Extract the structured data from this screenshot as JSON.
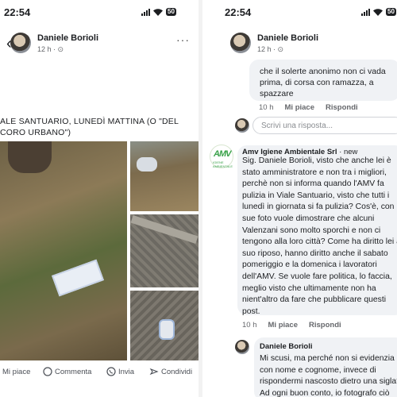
{
  "left": {
    "status": {
      "time": "22:54",
      "battery": "50"
    },
    "author": {
      "name": "Daniele Borioli",
      "meta": "12 h · ⊙"
    },
    "post_text": "ALE SANTUARIO, LUNEDÌ MATTINA (O \"DEL\nCORO URBANO\")",
    "actions": {
      "like": "Mi piace",
      "comment": "Commenta",
      "send": "Invia",
      "share": "Condividi"
    }
  },
  "right": {
    "status": {
      "time": "22:54",
      "battery": "50"
    },
    "author": {
      "name": "Daniele Borioli",
      "meta": "12 h · ⊙"
    },
    "prev_comment": "che il solerte anonimo non ci vada\nprima, di corsa con ramazza, a\nspazzare",
    "prev_links": {
      "time": "10 h",
      "like": "Mi piace",
      "reply": "Rispondi"
    },
    "reply_placeholder": "Scrivi una risposta...",
    "amv_comment": {
      "author": "Amv Igiene Ambientale Srl",
      "badge": "· new",
      "logo_text": "AMV",
      "logo_sub": "IGIENE AMBIENTALE",
      "text": "Sig. Daniele Borioli, visto che anche lei è stato amministratore e non tra i migliori, perchè non si informa quando l'AMV fa pulizia in Viale Santuario, visto che tutti i lunedì in giornata si fa pulizia? Cos'è, con le sue foto vuole dimostrare che alcuni Valenzani sono molto sporchi e non ci tengono alla loro città? Come ha diritto lei al suo riposo, hanno diritto anche il sabato pomeriggio e la domenica i lavoratori dell'AMV. Se vuole fare politica, lo faccia, meglio visto che ultimamente non ha nient'altro da fare che pubblicare questi post.",
      "links": {
        "time": "10 h",
        "like": "Mi piace",
        "reply": "Rispondi"
      }
    },
    "reply_comment": {
      "author": "Daniele Borioli",
      "text": "Mi scusi, ma perché non si evidenzia con nome e cognome, invece di rispondermi nascosto dietro una sigla? Ad ogni buon conto, io fotografo ciò"
    }
  }
}
